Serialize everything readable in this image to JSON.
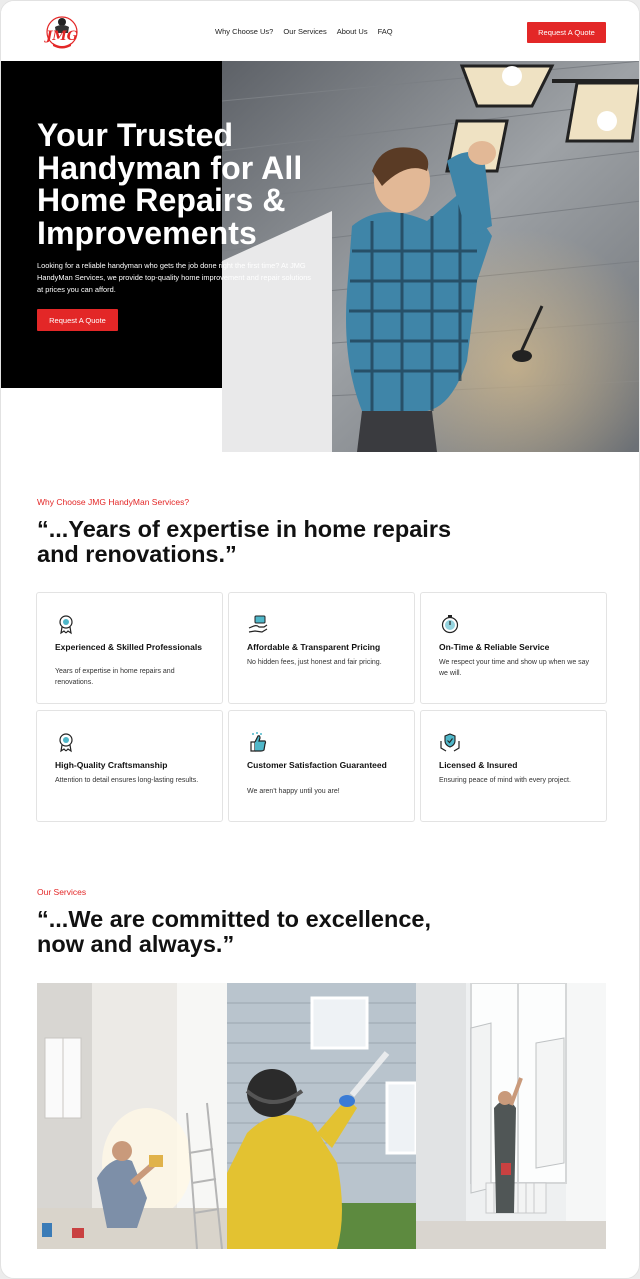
{
  "header": {
    "logo_text": "JMG",
    "nav": [
      "Why Choose Us?",
      "Our Services",
      "About Us",
      "FAQ"
    ],
    "cta": "Request A Quote"
  },
  "hero": {
    "title": "Your Trusted Handyman for All Home Repairs & Improvements",
    "text": "Looking for a reliable handyman who gets the job done right the first time? At JMG HandyMan Services, we provide top-quality home improvement and repair solutions at prices you can afford.",
    "cta": "Request A Quote"
  },
  "why": {
    "eyebrow": "Why Choose JMG HandyMan Services?",
    "quote": "“...Years of expertise in home repairs and renovations.”",
    "cards": [
      {
        "icon": "award-ribbon-icon",
        "title": "Experienced & Skilled Professionals",
        "desc": "Years of expertise in home repairs and renovations."
      },
      {
        "icon": "money-hand-icon",
        "title": "Affordable & Transparent Pricing",
        "desc": "No hidden fees, just honest and fair pricing."
      },
      {
        "icon": "stopwatch-icon",
        "title": "On-Time & Reliable Service",
        "desc": "We respect your time and show up when we say we will."
      },
      {
        "icon": "award-ribbon-icon",
        "title": "High-Quality Craftsmanship",
        "desc": "Attention to detail ensures long-lasting results."
      },
      {
        "icon": "thumbs-up-icon",
        "title": "Customer Satisfaction Guaranteed",
        "desc": "We aren't happy until you are!"
      },
      {
        "icon": "shield-hands-icon",
        "title": "Licensed & Insured",
        "desc": "Ensuring peace of mind with every project."
      }
    ]
  },
  "services": {
    "eyebrow": "Our Services",
    "quote": "“...We are committed to excellence, now and always.”"
  },
  "colors": {
    "accent": "#e32727",
    "hero_bg": "#000000"
  }
}
